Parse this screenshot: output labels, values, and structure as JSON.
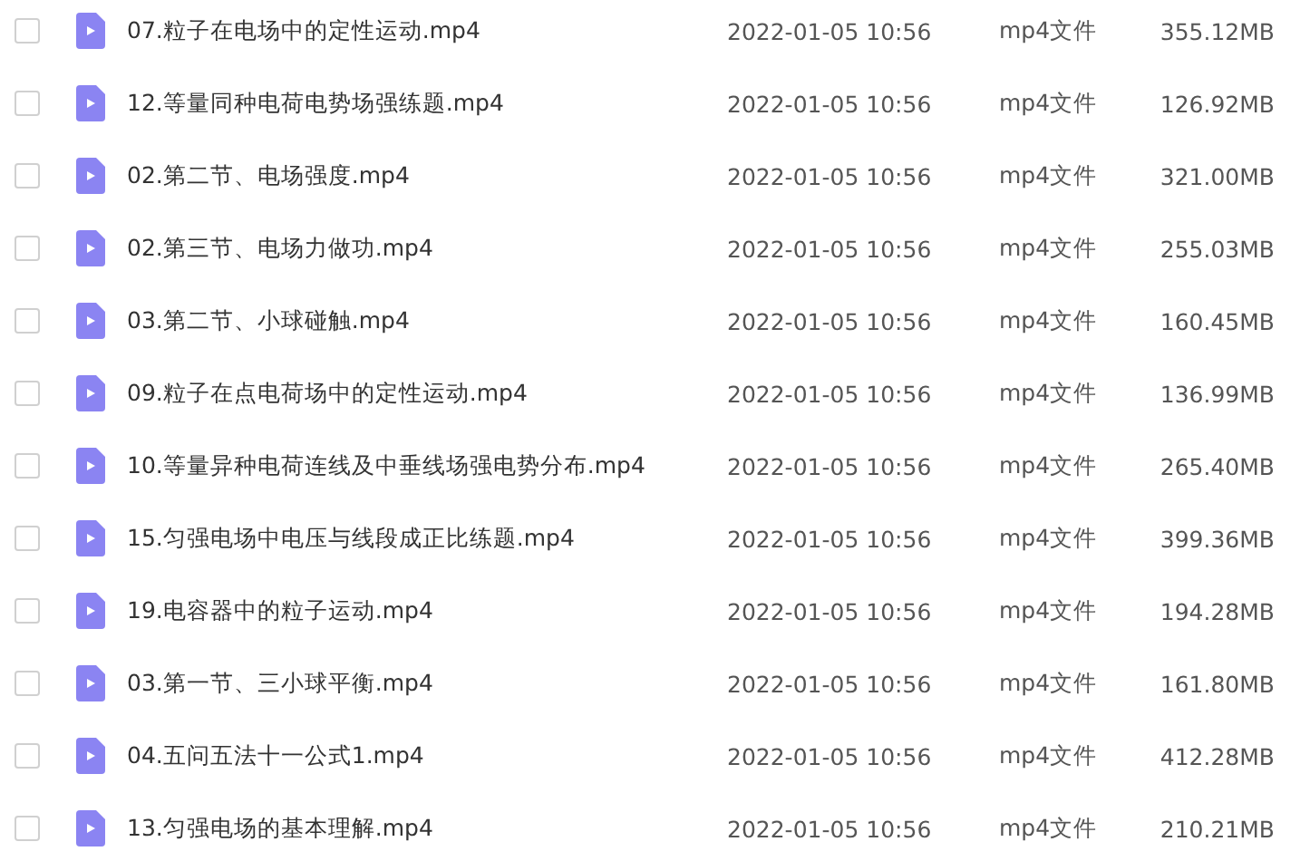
{
  "files": [
    {
      "name": "07.粒子在电场中的定性运动.mp4",
      "date": "2022-01-05 10:56",
      "type": "mp4文件",
      "size": "355.12MB",
      "checked": false
    },
    {
      "name": "12.等量同种电荷电势场强练题.mp4",
      "date": "2022-01-05 10:56",
      "type": "mp4文件",
      "size": "126.92MB",
      "checked": false
    },
    {
      "name": "02.第二节、电场强度.mp4",
      "date": "2022-01-05 10:56",
      "type": "mp4文件",
      "size": "321.00MB",
      "checked": false
    },
    {
      "name": "02.第三节、电场力做功.mp4",
      "date": "2022-01-05 10:56",
      "type": "mp4文件",
      "size": "255.03MB",
      "checked": false
    },
    {
      "name": "03.第二节、小球碰触.mp4",
      "date": "2022-01-05 10:56",
      "type": "mp4文件",
      "size": "160.45MB",
      "checked": false
    },
    {
      "name": "09.粒子在点电荷场中的定性运动.mp4",
      "date": "2022-01-05 10:56",
      "type": "mp4文件",
      "size": "136.99MB",
      "checked": false
    },
    {
      "name": "10.等量异种电荷连线及中垂线场强电势分布.mp4",
      "date": "2022-01-05 10:56",
      "type": "mp4文件",
      "size": "265.40MB",
      "checked": false
    },
    {
      "name": "15.匀强电场中电压与线段成正比练题.mp4",
      "date": "2022-01-05 10:56",
      "type": "mp4文件",
      "size": "399.36MB",
      "checked": false
    },
    {
      "name": "19.电容器中的粒子运动.mp4",
      "date": "2022-01-05 10:56",
      "type": "mp4文件",
      "size": "194.28MB",
      "checked": false
    },
    {
      "name": "03.第一节、三小球平衡.mp4",
      "date": "2022-01-05 10:56",
      "type": "mp4文件",
      "size": "161.80MB",
      "checked": false
    },
    {
      "name": "04.五问五法十一公式1.mp4",
      "date": "2022-01-05 10:56",
      "type": "mp4文件",
      "size": "412.28MB",
      "checked": false
    },
    {
      "name": "13.匀强电场的基本理解.mp4",
      "date": "2022-01-05 10:56",
      "type": "mp4文件",
      "size": "210.21MB",
      "checked": false
    }
  ]
}
